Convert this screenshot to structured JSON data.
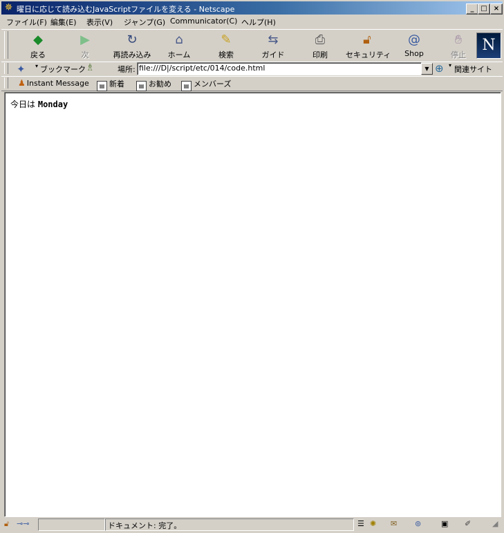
{
  "window": {
    "title": "曜日に応じて読み込むJavaScriptファイルを変える - Netscape",
    "minimize": "_",
    "maximize": "□",
    "close": "×"
  },
  "menu": [
    "ファイル(F)",
    "編集(E)",
    "表示(V)",
    "ジャンプ(G)",
    "Communicator(C)",
    "ヘルプ(H)"
  ],
  "nav_toolbar": {
    "buttons": [
      {
        "label": "戻る",
        "icon": "back-arrow-icon",
        "enabled": true
      },
      {
        "label": "次",
        "icon": "forward-arrow-icon",
        "enabled": false
      },
      {
        "label": "再読み込み",
        "icon": "reload-icon",
        "enabled": true
      },
      {
        "label": "ホーム",
        "icon": "home-icon",
        "enabled": true
      },
      {
        "label": "検索",
        "icon": "search-icon",
        "enabled": true
      },
      {
        "label": "ガイド",
        "icon": "guide-icon",
        "enabled": true
      },
      {
        "label": "印刷",
        "icon": "printer-icon",
        "enabled": true
      },
      {
        "label": "セキュリティ",
        "icon": "lock-icon",
        "enabled": true
      },
      {
        "label": "Shop",
        "icon": "shop-icon",
        "enabled": true
      },
      {
        "label": "停止",
        "icon": "stop-icon",
        "enabled": false
      }
    ],
    "logo": "N"
  },
  "location_bar": {
    "bookmarks_label": "ブックマーク",
    "location_label": "場所:",
    "url": "file:///D|/script/etc/014/code.html",
    "related_label": "関連サイト"
  },
  "personal_toolbar": {
    "items": [
      "Instant Message",
      "新着",
      "お勧め",
      "メンバーズ"
    ]
  },
  "page": {
    "prefix": "今日は",
    "day": "Monday"
  },
  "status": {
    "text": "ドキュメント: 完了。"
  }
}
